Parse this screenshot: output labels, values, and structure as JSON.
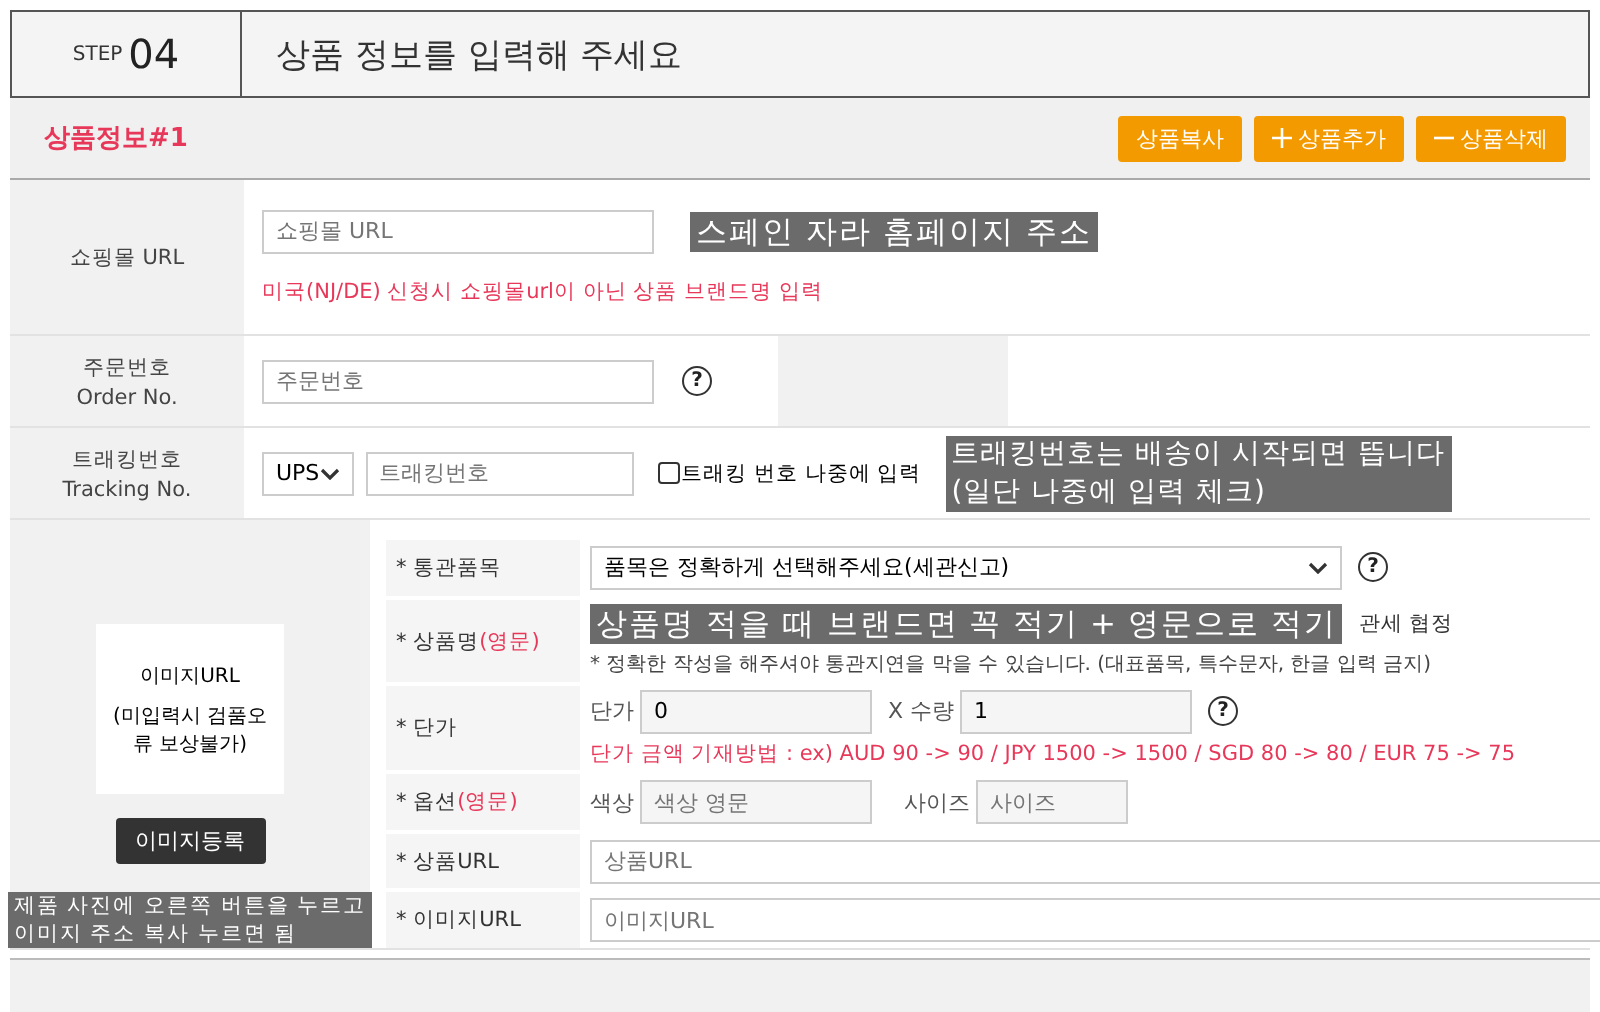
{
  "step": {
    "label": "STEP",
    "number": "04",
    "title": "상품 정보를 입력해 주세요"
  },
  "product": {
    "title": "상품정보#1",
    "buttons": [
      {
        "label": "상품복사"
      },
      {
        "label": "상품추가"
      },
      {
        "label": "상품삭제"
      }
    ]
  },
  "shop_url": {
    "label": "쇼핑몰 URL",
    "placeholder": "쇼핑몰 URL",
    "notice": "미국(NJ/DE) 신청시 쇼핑몰url이 아닌 상품 브랜드명 입력",
    "annotation": "스페인 자라 홈페이지 주소"
  },
  "order": {
    "label": "주문번호",
    "label_en": "Order No.",
    "placeholder": "주문번호",
    "help": "?"
  },
  "tracking": {
    "label": "트래킹번호",
    "label_en": "Tracking No.",
    "carrier": "UPS",
    "placeholder": "트래킹번호",
    "later": {
      "label": "트래킹 번호 나중에 입력",
      "checked": false
    },
    "annotation": "트래킹번호는 배송이 시작되면 뜹니다\n(일단 나중에 입력 체크)"
  },
  "image": {
    "label": "이미지URL",
    "note": "(미입력시 검품오류 보상불가)",
    "button": "이미지등록",
    "annotation": "제품 사진에 오른쪽 버튼을 누르고\n이미지 주소 복사 누르면 됨"
  },
  "fields": [
    {
      "kind": "select",
      "label": "* 통관품목",
      "value": "품목은 정확하게 선택해주세요(세관신고)",
      "help": "?"
    },
    {
      "kind": "name",
      "label": "* 상품명",
      "suffix": "(영문)",
      "annotation": "상품명 적을 때 브랜드면 꼭 적기 + 영문으로 적기",
      "side_note": "관세 협정",
      "note": "* 정확한 작성을 해주셔야 통관지연을 막을 수 있습니다. (대표품목, 특수문자, 한글 입력 금지)"
    },
    {
      "kind": "price",
      "label": "* 단가",
      "price_label": "단가",
      "price": "0",
      "qty_label": "X 수량",
      "qty": "1",
      "help": "?",
      "notice": "단가 금액 기재방법 : ex) AUD 90 -> 90 / JPY 1500 -> 1500 / SGD 80 -> 80 / EUR 75 -> 75"
    },
    {
      "kind": "option",
      "label": "* 옵션",
      "suffix": "(영문)",
      "color_label": "색상",
      "color_placeholder": "색상 영문",
      "size_label": "사이즈",
      "size_placeholder": "사이즈"
    },
    {
      "kind": "text",
      "label": "* 상품URL",
      "placeholder": "상품URL"
    },
    {
      "kind": "text",
      "label": "* 이미지URL",
      "placeholder": "이미지URL"
    }
  ]
}
